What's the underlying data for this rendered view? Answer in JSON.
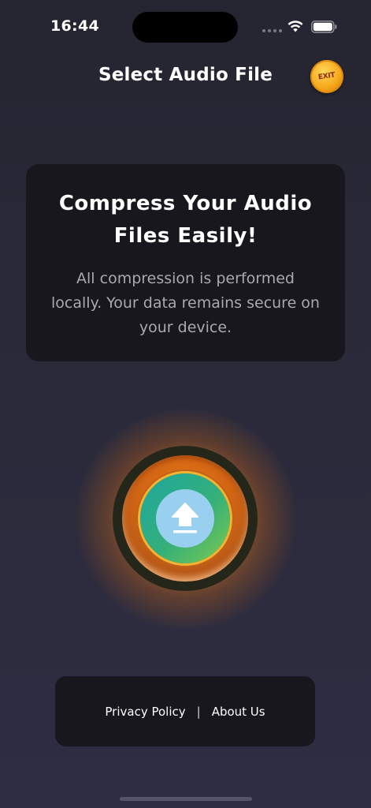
{
  "status_bar": {
    "time": "16:44",
    "icons": [
      "signal-dots-icon",
      "wifi-icon",
      "battery-icon"
    ]
  },
  "header": {
    "title": "Select Audio File",
    "exit_label": "EXIT",
    "exit_icon": "exit-coin-icon"
  },
  "info_card": {
    "heading": "Compress Your Audio Files Easily!",
    "body": "All compression is performed locally. Your data remains secure on your device."
  },
  "upload": {
    "icon": "upload-arrow-icon"
  },
  "footer": {
    "privacy_label": "Privacy Policy",
    "divider": "|",
    "about_label": "About Us"
  },
  "colors": {
    "background": "#2a2a3a",
    "card": "#17171d",
    "accent_orange": "#e9781c",
    "accent_teal": "#1ea6a0",
    "accent_green": "#7dc94f",
    "upload_circle": "#9ad0ef",
    "exit_gold": "#f7a81b",
    "body_text": "#a9a9b3"
  }
}
